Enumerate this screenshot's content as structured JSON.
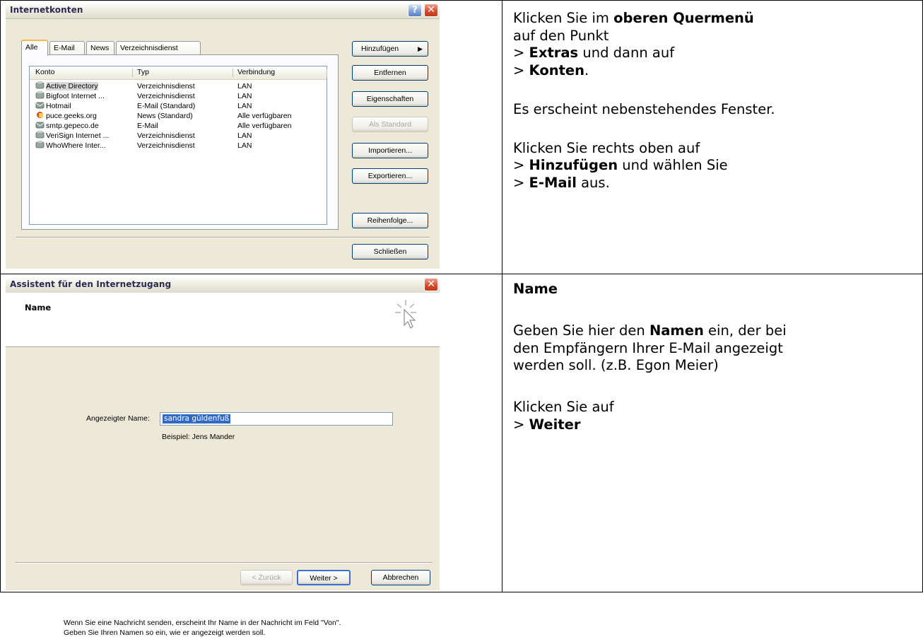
{
  "window1": {
    "title": "Internetkonten",
    "tabs": [
      "Alle",
      "E-Mail",
      "News",
      "Verzeichnisdienst"
    ],
    "columns": [
      "Konto",
      "Typ",
      "Verbindung"
    ],
    "accounts": [
      {
        "konto": "Active Directory",
        "typ": "Verzeichnisdienst",
        "verbindung": "LAN",
        "icon": "directory-icon"
      },
      {
        "konto": "Bigfoot Internet ...",
        "typ": "Verzeichnisdienst",
        "verbindung": "LAN",
        "icon": "directory-icon"
      },
      {
        "konto": "Hotmail",
        "typ": "E-Mail (Standard)",
        "verbindung": "LAN",
        "icon": "mail-icon"
      },
      {
        "konto": "puce.geeks.org",
        "typ": "News (Standard)",
        "verbindung": "Alle verfügbaren",
        "icon": "news-icon"
      },
      {
        "konto": "smtp.gepeco.de",
        "typ": "E-Mail",
        "verbindung": "Alle verfügbaren",
        "icon": "mail-icon"
      },
      {
        "konto": "VeriSign Internet ...",
        "typ": "Verzeichnisdienst",
        "verbindung": "LAN",
        "icon": "directory-icon"
      },
      {
        "konto": "WhoWhere Inter...",
        "typ": "Verzeichnisdienst",
        "verbindung": "LAN",
        "icon": "directory-icon"
      }
    ],
    "buttons": {
      "add": "Hinzufügen",
      "remove": "Entfernen",
      "properties": "Eigenschaften",
      "default": "Als Standard",
      "import": "Importieren...",
      "export": "Exportieren...",
      "order": "Reihenfolge...",
      "close": "Schließen"
    }
  },
  "window2": {
    "title": "Assistent für den Internetzugang",
    "header": "Name",
    "desc1": "Wenn Sie eine Nachricht senden, erscheint Ihr Name in der Nachricht im Feld \"Von\".",
    "desc2": "Geben Sie Ihren Namen so ein, wie er angezeigt werden soll.",
    "field_label": "Angezeigter Name:",
    "field_value": "sandra güldenfuß",
    "example": "Beispiel: Jens Mander",
    "buttons": {
      "back": "< Zurück",
      "next": "Weiter >",
      "cancel": "Abbrechen"
    }
  },
  "instructions1": {
    "l1a": "Klicken Sie im ",
    "l1b": "oberen Quermenü",
    "l2": "auf den Punkt",
    "l3a": "> ",
    "l3b": "Extras",
    "l3c": " und dann auf",
    "l4a": "> ",
    "l4b": "Konten",
    "l4c": ".",
    "l5": "Es erscheint nebenstehendes Fenster.",
    "l6": "Klicken Sie rechts oben auf",
    "l7a": "> ",
    "l7b": "Hinzufügen",
    "l7c": " und wählen Sie",
    "l8a": "> ",
    "l8b": "E-Mail",
    "l8c": " aus."
  },
  "instructions2": {
    "heading": "Name",
    "l1a": "Geben Sie hier den ",
    "l1b": "Namen",
    "l1c": " ein, der bei",
    "l2": "den Empfängern Ihrer E-Mail angezeigt",
    "l3": "werden soll. (z.B. Egon Meier)",
    "l4": "Klicken Sie auf",
    "l5a": "> ",
    "l5b": "Weiter"
  }
}
